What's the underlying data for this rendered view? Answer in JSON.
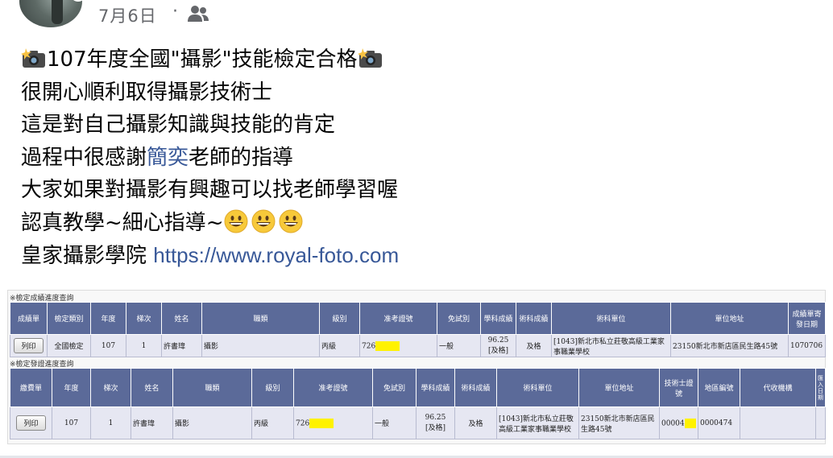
{
  "header": {
    "date": "7月6日",
    "separator": "·",
    "audience_icon": "friends-icon",
    "online_color": "#42b72a"
  },
  "post": {
    "line1": {
      "text": "107年度全國\"攝影\"技能檢定合格",
      "icon": "camera-flash-icon"
    },
    "line2": "很開心順利取得攝影技術士",
    "line3": "這是對自己攝影知識與技能的肯定",
    "line4": {
      "before": "過程中很感謝",
      "mention": "簡奕",
      "after": "老師的指導"
    },
    "line5": "大家如果對攝影有興趣可以找老師學習喔",
    "line6": {
      "text": "認真教學~細心指導~",
      "emoji": "grinning-face-icon"
    },
    "line7": {
      "before": "皇家攝影學院 ",
      "link": "https://www.royal-foto.com"
    },
    "link_color": "#385898"
  },
  "score_table": {
    "label": "※檢定成績進度查詢",
    "headers": [
      "成績單",
      "檢定類別",
      "年度",
      "梯次",
      "姓名",
      "職類",
      "級別",
      "准考證號",
      "免試別",
      "學科成績",
      "術科成績",
      "術科單位",
      "單位地址",
      "成績單寄發日期"
    ],
    "row": {
      "button": "列印",
      "category": "全國檢定",
      "year": "107",
      "batch": "1",
      "name": "許書瑋",
      "job": "攝影",
      "level": "丙級",
      "ticket": "726",
      "exempt": "一般",
      "written_score": "96.25",
      "written_result": "[及格]",
      "practical": "及格",
      "unit": "[1043]新北市私立莊敬高級工業家事職業學校",
      "address": "23150新北市新店區民生路45號",
      "mail_date": "1070706"
    }
  },
  "license_table": {
    "label": "※檢定發證進度查詢",
    "headers": [
      "繳費單",
      "年度",
      "梯次",
      "姓名",
      "職類",
      "級別",
      "准考證號",
      "免試別",
      "學科成績",
      "術科成績",
      "術科單位",
      "單位地址",
      "技術士證號",
      "地區編號",
      "代收機構",
      "匯入日期"
    ],
    "row": {
      "button": "列印",
      "year": "107",
      "batch": "1",
      "name": "許書瑋",
      "job": "攝影",
      "level": "丙級",
      "ticket": "726",
      "exempt": "一般",
      "written_score": "96.25",
      "written_result": "[及格]",
      "practical": "及格",
      "unit": "[1043]新北市私立莊敬高級工業家事職業學校",
      "address": "23150新北市新店區民生路45號",
      "cert_no": "00004",
      "area_no": "0000474",
      "agency": "",
      "import_date": ""
    }
  }
}
